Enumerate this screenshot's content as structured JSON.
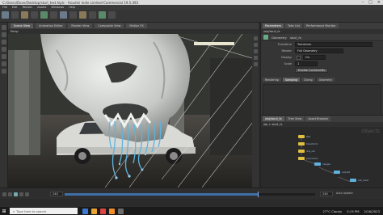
{
  "window": {
    "title": "C:/Users/Dave/Desktop/skull_test.hiplc - Houdini Indie Limited-Commercial 19.5.493"
  },
  "menubar": {
    "items": [
      "File",
      "Edit",
      "Render",
      "Assets",
      "Windows",
      "Help"
    ]
  },
  "viewport": {
    "tabs": [
      "Scene View",
      "Animation Editor",
      "Render View",
      "Composite View",
      "Motion FX"
    ],
    "active_tab": "Scene View",
    "camera_label": "Persp"
  },
  "parameters": {
    "tabs": [
      "Parameters",
      "Take List",
      "Performance Monitor"
    ],
    "path": "/obj/skull_fx",
    "node_type": "Geometry",
    "node_name": "skull_fx",
    "rows": [
      {
        "label": "Transform",
        "value": "Transform"
      },
      {
        "label": "Render",
        "value": "Full Geometry"
      },
      {
        "label": "Display",
        "value": "On"
      },
      {
        "label": "Scale",
        "value": "1"
      }
    ],
    "misc_button": "Enable Constraints",
    "subtabs": [
      "Rendering",
      "Sampling",
      "Dicing",
      "Geometry"
    ],
    "active_subtab": "Sampling"
  },
  "network": {
    "tabs": [
      "/obj/skull_fx",
      "Tree View",
      "Asset Browser"
    ],
    "path": "obj > skull_fx",
    "context_label": "Objects",
    "nodes": [
      {
        "name": "file1",
        "color": "#e0c040"
      },
      {
        "name": "transform1",
        "color": "#e0c040"
      },
      {
        "name": "drip_sim",
        "color": "#e0c040"
      },
      {
        "name": "polyreduce",
        "color": "#e0c040"
      },
      {
        "name": "merge1",
        "color": "#60b0e0"
      },
      {
        "name": "output0",
        "color": "#60b0e0"
      },
      {
        "name": "vdb_mesh",
        "color": "#60b0e0"
      }
    ]
  },
  "timeline": {
    "current_frame": "240",
    "end_frame": "240",
    "progress": 0.77,
    "keys_label": "Auto Update"
  },
  "taskbar": {
    "search_placeholder": "Type here to search",
    "weather": "27°C  Cloudy",
    "time": "5:15 PM",
    "date": "2/16/2023"
  },
  "colors": {
    "skull": "#cfd1cf",
    "drips": "#5db4e0",
    "timeline_fill": "#3f6fa8"
  }
}
